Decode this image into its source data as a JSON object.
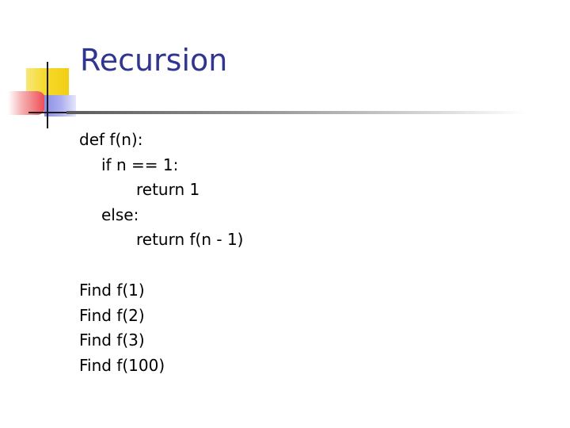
{
  "slide": {
    "title": "Recursion",
    "code": {
      "line1": "def f(n):",
      "line2": "if n == 1:",
      "line3": "return 1",
      "line4": "else:",
      "line5": "return f(n - 1)"
    },
    "tasks": [
      "Find f(1)",
      "Find f(2)",
      "Find f(3)",
      "Find f(100)"
    ]
  },
  "colors": {
    "title": "#2f3591",
    "logo_yellow": "#f6d92a",
    "logo_red": "#ee4b52",
    "logo_blue": "#8c8fe6"
  }
}
